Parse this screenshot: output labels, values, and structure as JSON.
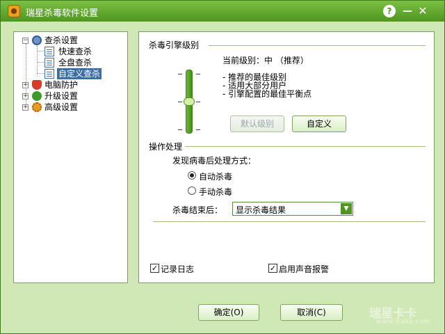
{
  "window": {
    "title": "瑞星杀毒软件设置"
  },
  "titlebar": {
    "help": "?",
    "minimize": "—",
    "close": "✕"
  },
  "tree": {
    "items": [
      {
        "label": "查杀设置",
        "expander": "−"
      },
      {
        "label": "快速查杀"
      },
      {
        "label": "全盘查杀"
      },
      {
        "label": "自定义查杀"
      },
      {
        "label": "电脑防护",
        "expander": "+"
      },
      {
        "label": "升级设置",
        "expander": "+"
      },
      {
        "label": "高级设置",
        "expander": "+"
      }
    ]
  },
  "engine": {
    "section_title": "杀毒引擎级别",
    "current_level": "当前级别：中 （推荐）",
    "desc": [
      "- 推荐的最佳级别",
      "- 适用大部分用户",
      "- 引擎配置的最佳平衡点"
    ],
    "default_button": "默认级别",
    "custom_button": "自定义",
    "level_fraction": 0.5
  },
  "operation": {
    "section_title": "操作处理",
    "found_label": "发现病毒后处理方式：",
    "radio_auto": "自动杀毒",
    "radio_manual": "手动杀毒",
    "after_label": "杀毒结束后：",
    "after_value": "显示杀毒结果"
  },
  "options": {
    "log": "记录日志",
    "sound": "启用声音报警"
  },
  "footer": {
    "ok": "确定(O)",
    "cancel": "取消(C)"
  },
  "watermark": {
    "brand": "瑞星卡卡",
    "url": "www.ikaka.com"
  },
  "colors": {
    "accent": "#4e961e",
    "panel_bg": "#cfe8b6"
  }
}
